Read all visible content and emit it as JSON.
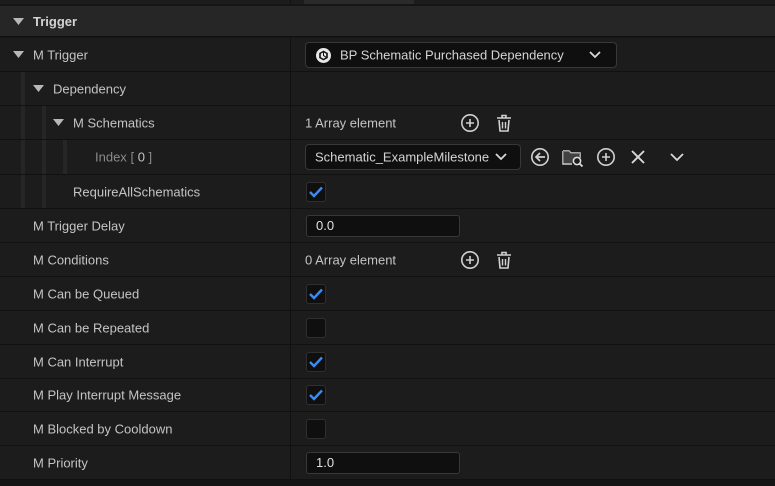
{
  "section": {
    "title": "Trigger"
  },
  "m_trigger": {
    "label": "M Trigger",
    "value": "BP Schematic Purchased Dependency",
    "icon": "unreal-engine-icon"
  },
  "dependency": {
    "label": "Dependency"
  },
  "m_schematics": {
    "label": "M Schematics",
    "summary": "1 Array element"
  },
  "index_row": {
    "label": "Index",
    "index_open": "[",
    "index_value": "0",
    "index_close": "]",
    "value": "Schematic_ExampleMilestone"
  },
  "require_all": {
    "label": "RequireAllSchematics",
    "checked": true
  },
  "trigger_delay": {
    "label": "M Trigger Delay",
    "value": "0.0"
  },
  "conditions": {
    "label": "M Conditions",
    "summary": "0 Array element"
  },
  "can_be_queued": {
    "label": "M Can be Queued",
    "checked": true
  },
  "can_be_repeated": {
    "label": "M Can be Repeated",
    "checked": false
  },
  "can_interrupt": {
    "label": "M Can Interrupt",
    "checked": true
  },
  "play_interrupt_message": {
    "label": "M Play Interrupt Message",
    "checked": true
  },
  "blocked_by_cooldown": {
    "label": "M Blocked by Cooldown",
    "checked": false
  },
  "priority": {
    "label": "M Priority",
    "value": "1.0"
  },
  "colors": {
    "checkmark": "#3a8bf2",
    "background": "#1c1c1c",
    "header": "#262626"
  }
}
